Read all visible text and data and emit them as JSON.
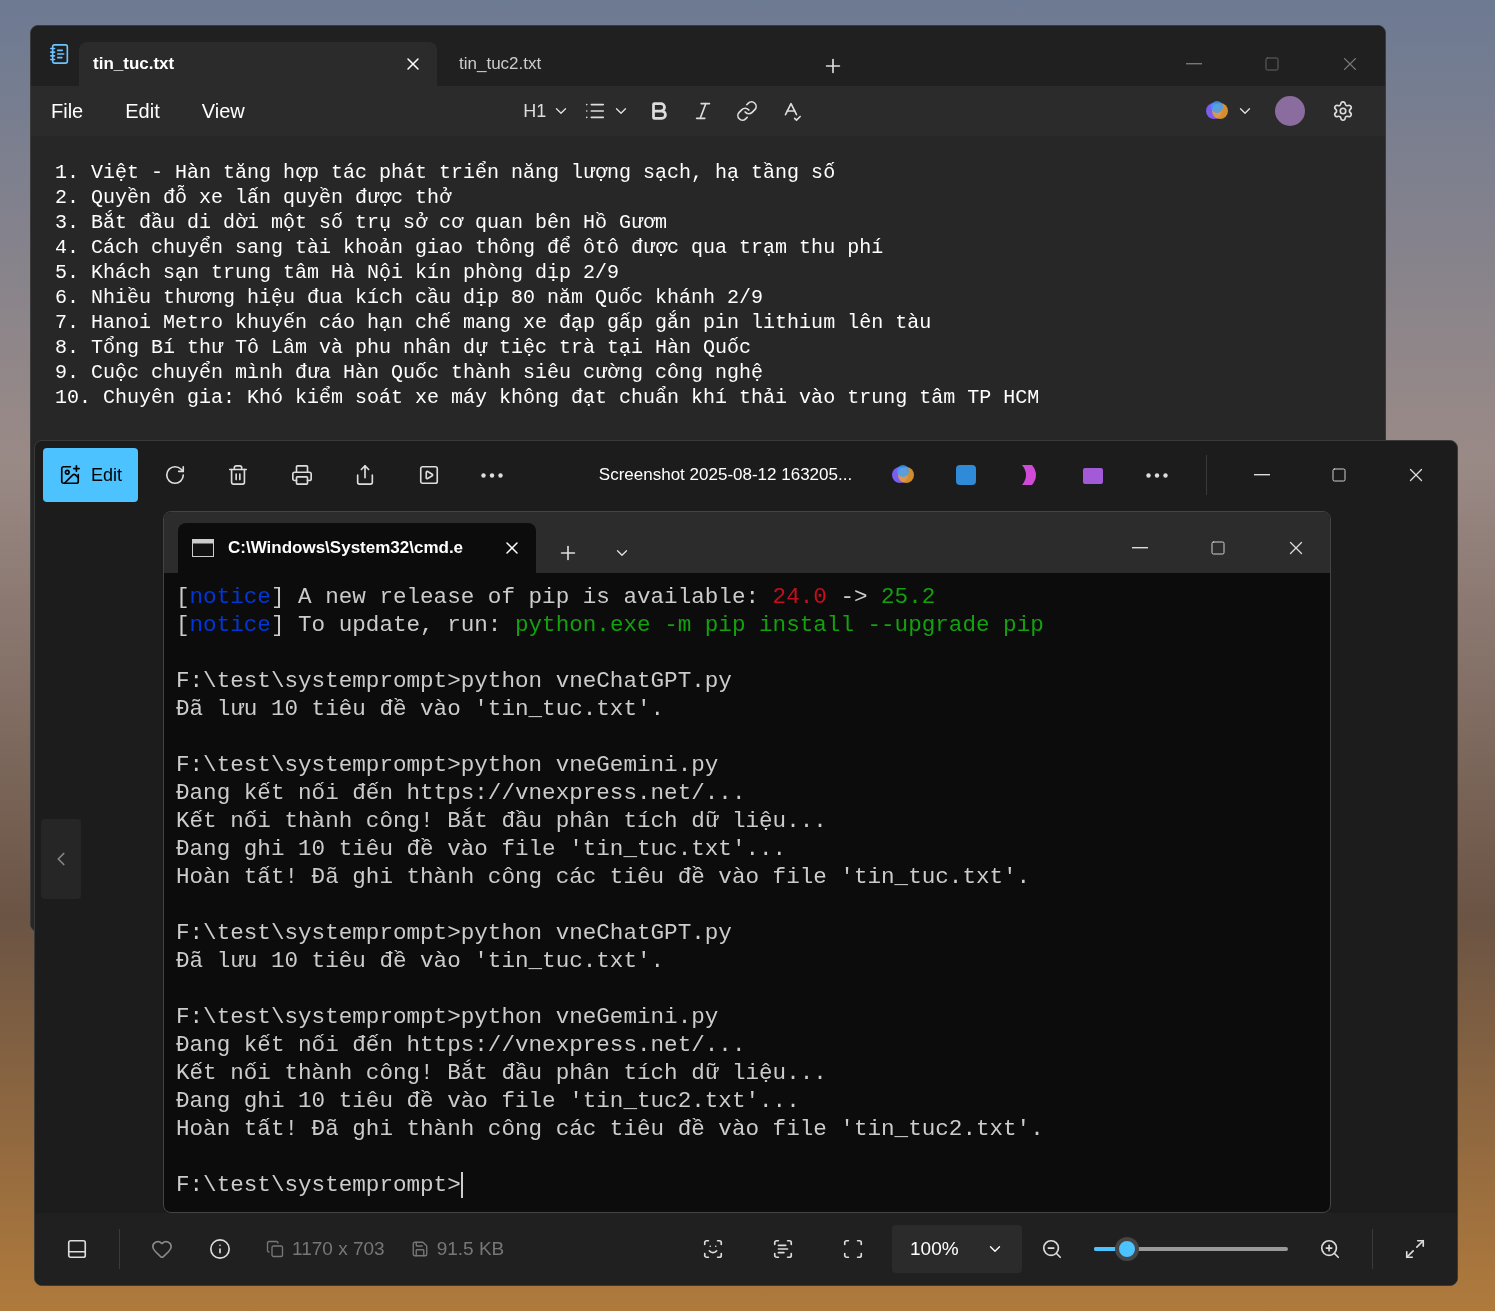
{
  "notepad": {
    "tabs": [
      {
        "label": "tin_tuc.txt",
        "selected": true
      },
      {
        "label": "tin_tuc2.txt",
        "selected": false
      }
    ],
    "menu": [
      "File",
      "Edit",
      "View"
    ],
    "heading_dropdown": "H1",
    "lines": [
      "1. Việt - Hàn tăng hợp tác phát triển năng lượng sạch, hạ tầng số",
      "2. Quyền đỗ xe lấn quyền được thở",
      "3. Bắt đầu di dời một số trụ sở cơ quan bên Hồ Gươm",
      "4. Cách chuyển sang tài khoản giao thông để ôtô được qua trạm thu phí",
      "5. Khách sạn trung tâm Hà Nội kín phòng dịp 2/9",
      "6. Nhiều thương hiệu đua kích cầu dịp 80 năm Quốc khánh 2/9",
      "7. Hanoi Metro khuyến cáo hạn chế mang xe đạp gấp gắn pin lithium lên tàu",
      "8. Tổng Bí thư Tô Lâm và phu nhân dự tiệc trà tại Hàn Quốc",
      "9. Cuộc chuyển mình đưa Hàn Quốc thành siêu cường công nghệ",
      "10. Chuyên gia: Khó kiểm soát xe máy không đạt chuẩn khí thải vào trung tâm TP HCM"
    ]
  },
  "photos": {
    "edit_button": "Edit",
    "title": "Screenshot 2025-08-12 163205...",
    "terminal": {
      "tab_title": "C:\\Windows\\System32\\cmd.e",
      "cursor": true,
      "blocks": [
        [
          [
            {
              "text": "[",
              "kind": "text"
            },
            {
              "text": "notice",
              "kind": "notice"
            },
            {
              "text": "] A new release of pip is available: ",
              "kind": "text"
            },
            {
              "text": "24.0",
              "kind": "error"
            },
            {
              "text": " -> ",
              "kind": "text"
            },
            {
              "text": "25.2",
              "kind": "success"
            }
          ],
          [
            {
              "text": "[",
              "kind": "text"
            },
            {
              "text": "notice",
              "kind": "notice"
            },
            {
              "text": "] To update, run: ",
              "kind": "text"
            },
            {
              "text": "python.exe -m pip install --upgrade pip",
              "kind": "success"
            }
          ]
        ],
        [
          [
            {
              "text": "F:\\test\\systemprompt>python vneChatGPT.py",
              "kind": "text"
            }
          ],
          [
            {
              "text": "Đã lưu 10 tiêu đề vào 'tin_tuc.txt'.",
              "kind": "text"
            }
          ]
        ],
        [
          [
            {
              "text": "F:\\test\\systemprompt>python vneGemini.py",
              "kind": "text"
            }
          ],
          [
            {
              "text": "Đang kết nối đến https://vnexpress.net/...",
              "kind": "text"
            }
          ],
          [
            {
              "text": "Kết nối thành công! Bắt đầu phân tích dữ liệu...",
              "kind": "text"
            }
          ],
          [
            {
              "text": "Đang ghi 10 tiêu đề vào file 'tin_tuc.txt'...",
              "kind": "text"
            }
          ],
          [
            {
              "text": "Hoàn tất! Đã ghi thành công các tiêu đề vào file 'tin_tuc.txt'.",
              "kind": "text"
            }
          ]
        ],
        [
          [
            {
              "text": "F:\\test\\systemprompt>python vneChatGPT.py",
              "kind": "text"
            }
          ],
          [
            {
              "text": "Đã lưu 10 tiêu đề vào 'tin_tuc.txt'.",
              "kind": "text"
            }
          ]
        ],
        [
          [
            {
              "text": "F:\\test\\systemprompt>python vneGemini.py",
              "kind": "text"
            }
          ],
          [
            {
              "text": "Đang kết nối đến https://vnexpress.net/...",
              "kind": "text"
            }
          ],
          [
            {
              "text": "Kết nối thành công! Bắt đầu phân tích dữ liệu...",
              "kind": "text"
            }
          ],
          [
            {
              "text": "Đang ghi 10 tiêu đề vào file 'tin_tuc2.txt'...",
              "kind": "text"
            }
          ],
          [
            {
              "text": "Hoàn tất! Đã ghi thành công các tiêu đề vào file 'tin_tuc2.txt'.",
              "kind": "text"
            }
          ]
        ],
        [
          [
            {
              "text": "F:\\test\\systemprompt>",
              "kind": "text"
            }
          ]
        ]
      ]
    },
    "status": {
      "dimensions": "1170 x 703",
      "file_size": "91.5 KB",
      "zoom": "100%"
    },
    "zoom_slider": {
      "level": 0.17
    }
  }
}
